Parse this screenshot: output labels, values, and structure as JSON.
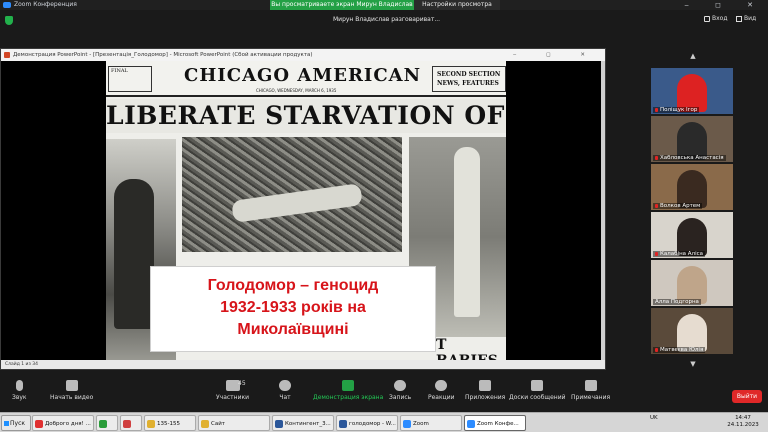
{
  "window": {
    "title": "Zoom Конференция",
    "controls": "‒ ◻ ✕"
  },
  "banner": {
    "viewing_screen": "Вы просматриваете экран Мирун Владислав",
    "view_options": "Настройки просмотра"
  },
  "meeting": {
    "talking": "Мирун Владислав разговариват...",
    "exit_label": "Вход",
    "view_label": "Вид"
  },
  "ppt": {
    "title": "Демонстрация PowerPoint - [Презентація_Голодомор] - Microsoft PowerPoint (Сбой активации продукта)",
    "status": "Слайд 1 из 34",
    "controls": "‒ ◻ ✕"
  },
  "slide": {
    "final": "FINAL",
    "newspaper": "CHICAGO  AMERICAN",
    "dateline": "CHICAGO, WEDNESDAY, MARCH 6, 1935",
    "section": "SECOND SECTION NEWS, FEATURES",
    "headline": "LIBERATE STARVATION OF PEASANTS",
    "babies": "T BABIES",
    "caption_lines": [
      "Голодомор – геноцид",
      "1932-1933 років на",
      "Миколаївщині"
    ]
  },
  "participants": [
    {
      "name": "Поліщук Ігор",
      "muted": true,
      "bg": "#3a5a8a",
      "color": "#d22"
    },
    {
      "name": "Хабловська Анастасія",
      "muted": true,
      "bg": "#6b5a4a",
      "color": "#2a2a2a"
    },
    {
      "name": "Волков Артем",
      "muted": true,
      "bg": "#8a6a4a",
      "color": "#3a2a20"
    },
    {
      "name": "Калабіна Аліса",
      "muted": true,
      "bg": "#d8d4cc",
      "color": "#2a2320"
    },
    {
      "name": "Алла Подгорна",
      "muted": false,
      "bg": "#cfc8bf",
      "color": "#bfa58a"
    },
    {
      "name": "Матвєєва Юлія",
      "muted": true,
      "bg": "#5a4a3a",
      "color": "#e6dcd0"
    }
  ],
  "toolbar": {
    "audio": "Звук",
    "video": "Начать видео",
    "participants": "Участники",
    "participants_count": "45",
    "chat": "Чат",
    "share": "Демонстрация экрана",
    "record": "Запись",
    "reactions": "Реакции",
    "apps": "Приложения",
    "whiteboards": "Доски сообщений",
    "notes": "Примечания",
    "leave": "Выйти"
  },
  "taskbar": {
    "start": "Пуск",
    "tasks": [
      {
        "label": "Доброго дня! ...",
        "color": "#e03030"
      },
      {
        "label": "",
        "color": "#2a9d3a"
      },
      {
        "label": "",
        "color": "#d04040"
      },
      {
        "label": "135-155",
        "color": "#e0b030"
      },
      {
        "label": "Сайт",
        "color": "#e0b030"
      },
      {
        "label": "Контингент_3...",
        "color": "#2b579a"
      },
      {
        "label": "голодомор - W...",
        "color": "#2b579a"
      },
      {
        "label": "Zoom",
        "color": "#2d8cff"
      },
      {
        "label": "Zoom Конфе...",
        "color": "#2d8cff"
      }
    ],
    "lang": "UK",
    "time": "14:47",
    "date": "24.11.2023"
  },
  "colors": {
    "zoom_blue": "#2d8cff",
    "banner_green": "#23a045",
    "leave_red": "#e02828",
    "caption_red": "#d7141a"
  }
}
